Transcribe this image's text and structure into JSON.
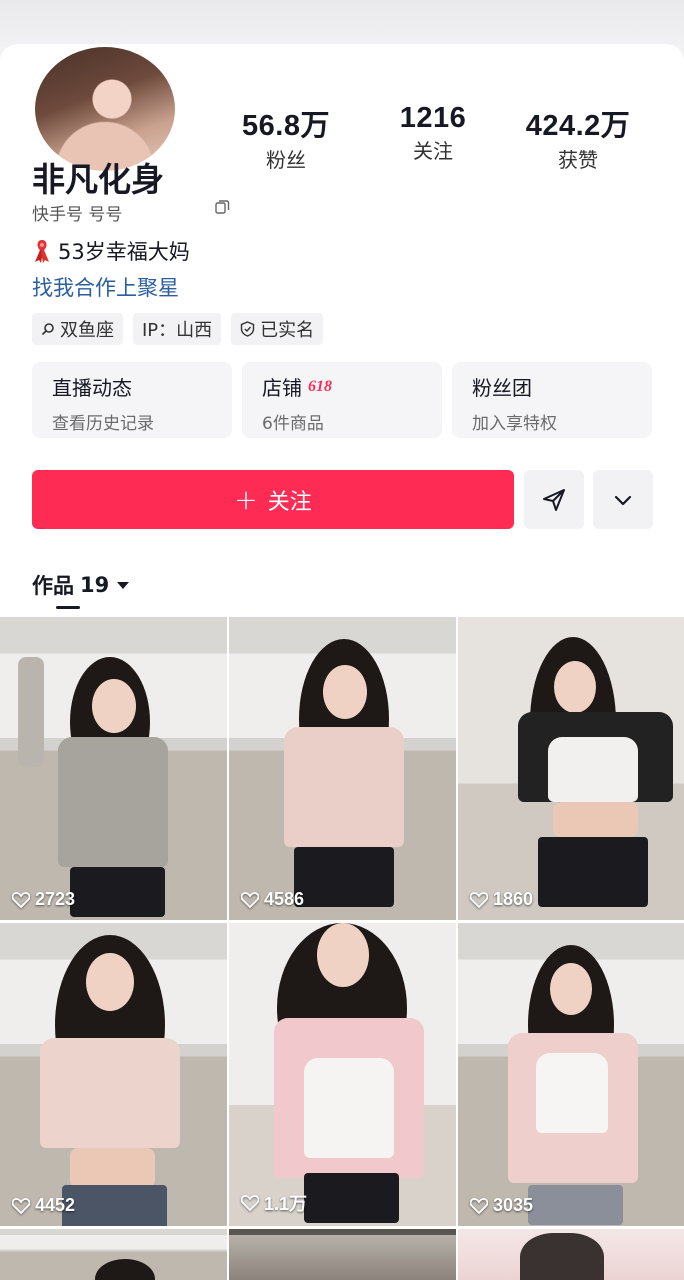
{
  "profile": {
    "nickname": "非凡化身",
    "kuaishou_id": "快手号 号号",
    "bio": "53岁幸福大妈",
    "cooperation_link": "找我合作上聚星"
  },
  "stats": [
    {
      "value": "56.8万",
      "label": "粉丝"
    },
    {
      "value": "1216",
      "label": "关注"
    },
    {
      "value": "424.2万",
      "label": "获赞"
    }
  ],
  "tags": [
    {
      "icon": "search-icon",
      "label": "双鱼座"
    },
    {
      "icon": "",
      "label": "IP：山西"
    },
    {
      "icon": "verified-shield-icon",
      "label": "已实名"
    }
  ],
  "cards": [
    {
      "title": "直播动态",
      "badge": "",
      "subtitle": "查看历史记录"
    },
    {
      "title": "店铺",
      "badge": "618",
      "subtitle": "6件商品"
    },
    {
      "title": "粉丝团",
      "badge": "",
      "subtitle": "加入享特权"
    }
  ],
  "actions": {
    "follow_label": "关注"
  },
  "works": {
    "label": "作品",
    "count": "19"
  },
  "videos": [
    {
      "likes": "2723"
    },
    {
      "likes": "4586"
    },
    {
      "likes": "1860"
    },
    {
      "likes": "4452"
    },
    {
      "likes": "1.1万"
    },
    {
      "likes": "3035"
    }
  ],
  "colors": {
    "accent": "#fe2c55",
    "link": "#2c5f9e",
    "card_bg": "#f5f5f7"
  }
}
